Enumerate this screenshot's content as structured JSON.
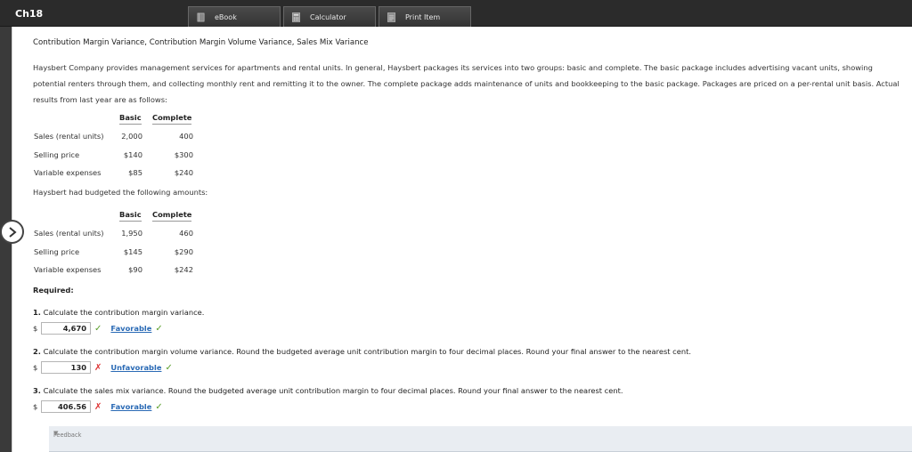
{
  "window": {
    "title": "Ch18"
  },
  "toolbar": {
    "ebook_label": "eBook",
    "calculator_label": "Calculator",
    "print_label": "Print Item"
  },
  "problem": {
    "heading": "Contribution Margin Variance, Contribution Margin Volume Variance, Sales Mix Variance",
    "paragraph": "Haysbert Company provides management services for apartments and rental units. In general, Haysbert packages its services into two groups: basic and complete. The basic package includes advertising vacant units, showing potential renters through them, and collecting monthly rent and remitting it to the owner. The complete package adds maintenance of units and bookkeeping to the basic package. Packages are priced on a per-rental unit basis. Actual results from last year are as follows:",
    "actual_table": {
      "headers": [
        "Basic",
        "Complete"
      ],
      "rows": [
        {
          "label": "Sales (rental units)",
          "basic": "2,000",
          "complete": "400"
        },
        {
          "label": "Selling price",
          "basic": "$140",
          "complete": "$300"
        },
        {
          "label": "Variable expenses",
          "basic": "$85",
          "complete": "$240"
        }
      ]
    },
    "budget_intro": "Haysbert had budgeted the following amounts:",
    "budget_table": {
      "headers": [
        "Basic",
        "Complete"
      ],
      "rows": [
        {
          "label": "Sales (rental units)",
          "basic": "1,950",
          "complete": "460"
        },
        {
          "label": "Selling price",
          "basic": "$145",
          "complete": "$290"
        },
        {
          "label": "Variable expenses",
          "basic": "$90",
          "complete": "$242"
        }
      ]
    },
    "required_label": "Required:",
    "questions": [
      {
        "num": "1.",
        "text": "Calculate the contribution margin variance.",
        "currency": "$",
        "answer": "4,670",
        "answer_mark": "check",
        "selection": "Favorable",
        "selection_mark": "check"
      },
      {
        "num": "2.",
        "text": "Calculate the contribution margin volume variance. Round the budgeted average unit contribution margin to four decimal places. Round your final answer to the nearest cent.",
        "currency": "$",
        "answer": "130",
        "answer_mark": "x",
        "selection": "Unfavorable",
        "selection_mark": "check"
      },
      {
        "num": "3.",
        "text": "Calculate the sales mix variance. Round the budgeted average unit contribution margin to four decimal places. Round your final answer to the nearest cent.",
        "currency": "$",
        "answer": "406.56",
        "answer_mark": "x",
        "selection": "Favorable",
        "selection_mark": "check"
      }
    ],
    "feedback_label": "Feedback"
  },
  "colors": {
    "correct": "#5a9e2a",
    "incorrect": "#dd3333",
    "link": "#2a6ab5"
  }
}
